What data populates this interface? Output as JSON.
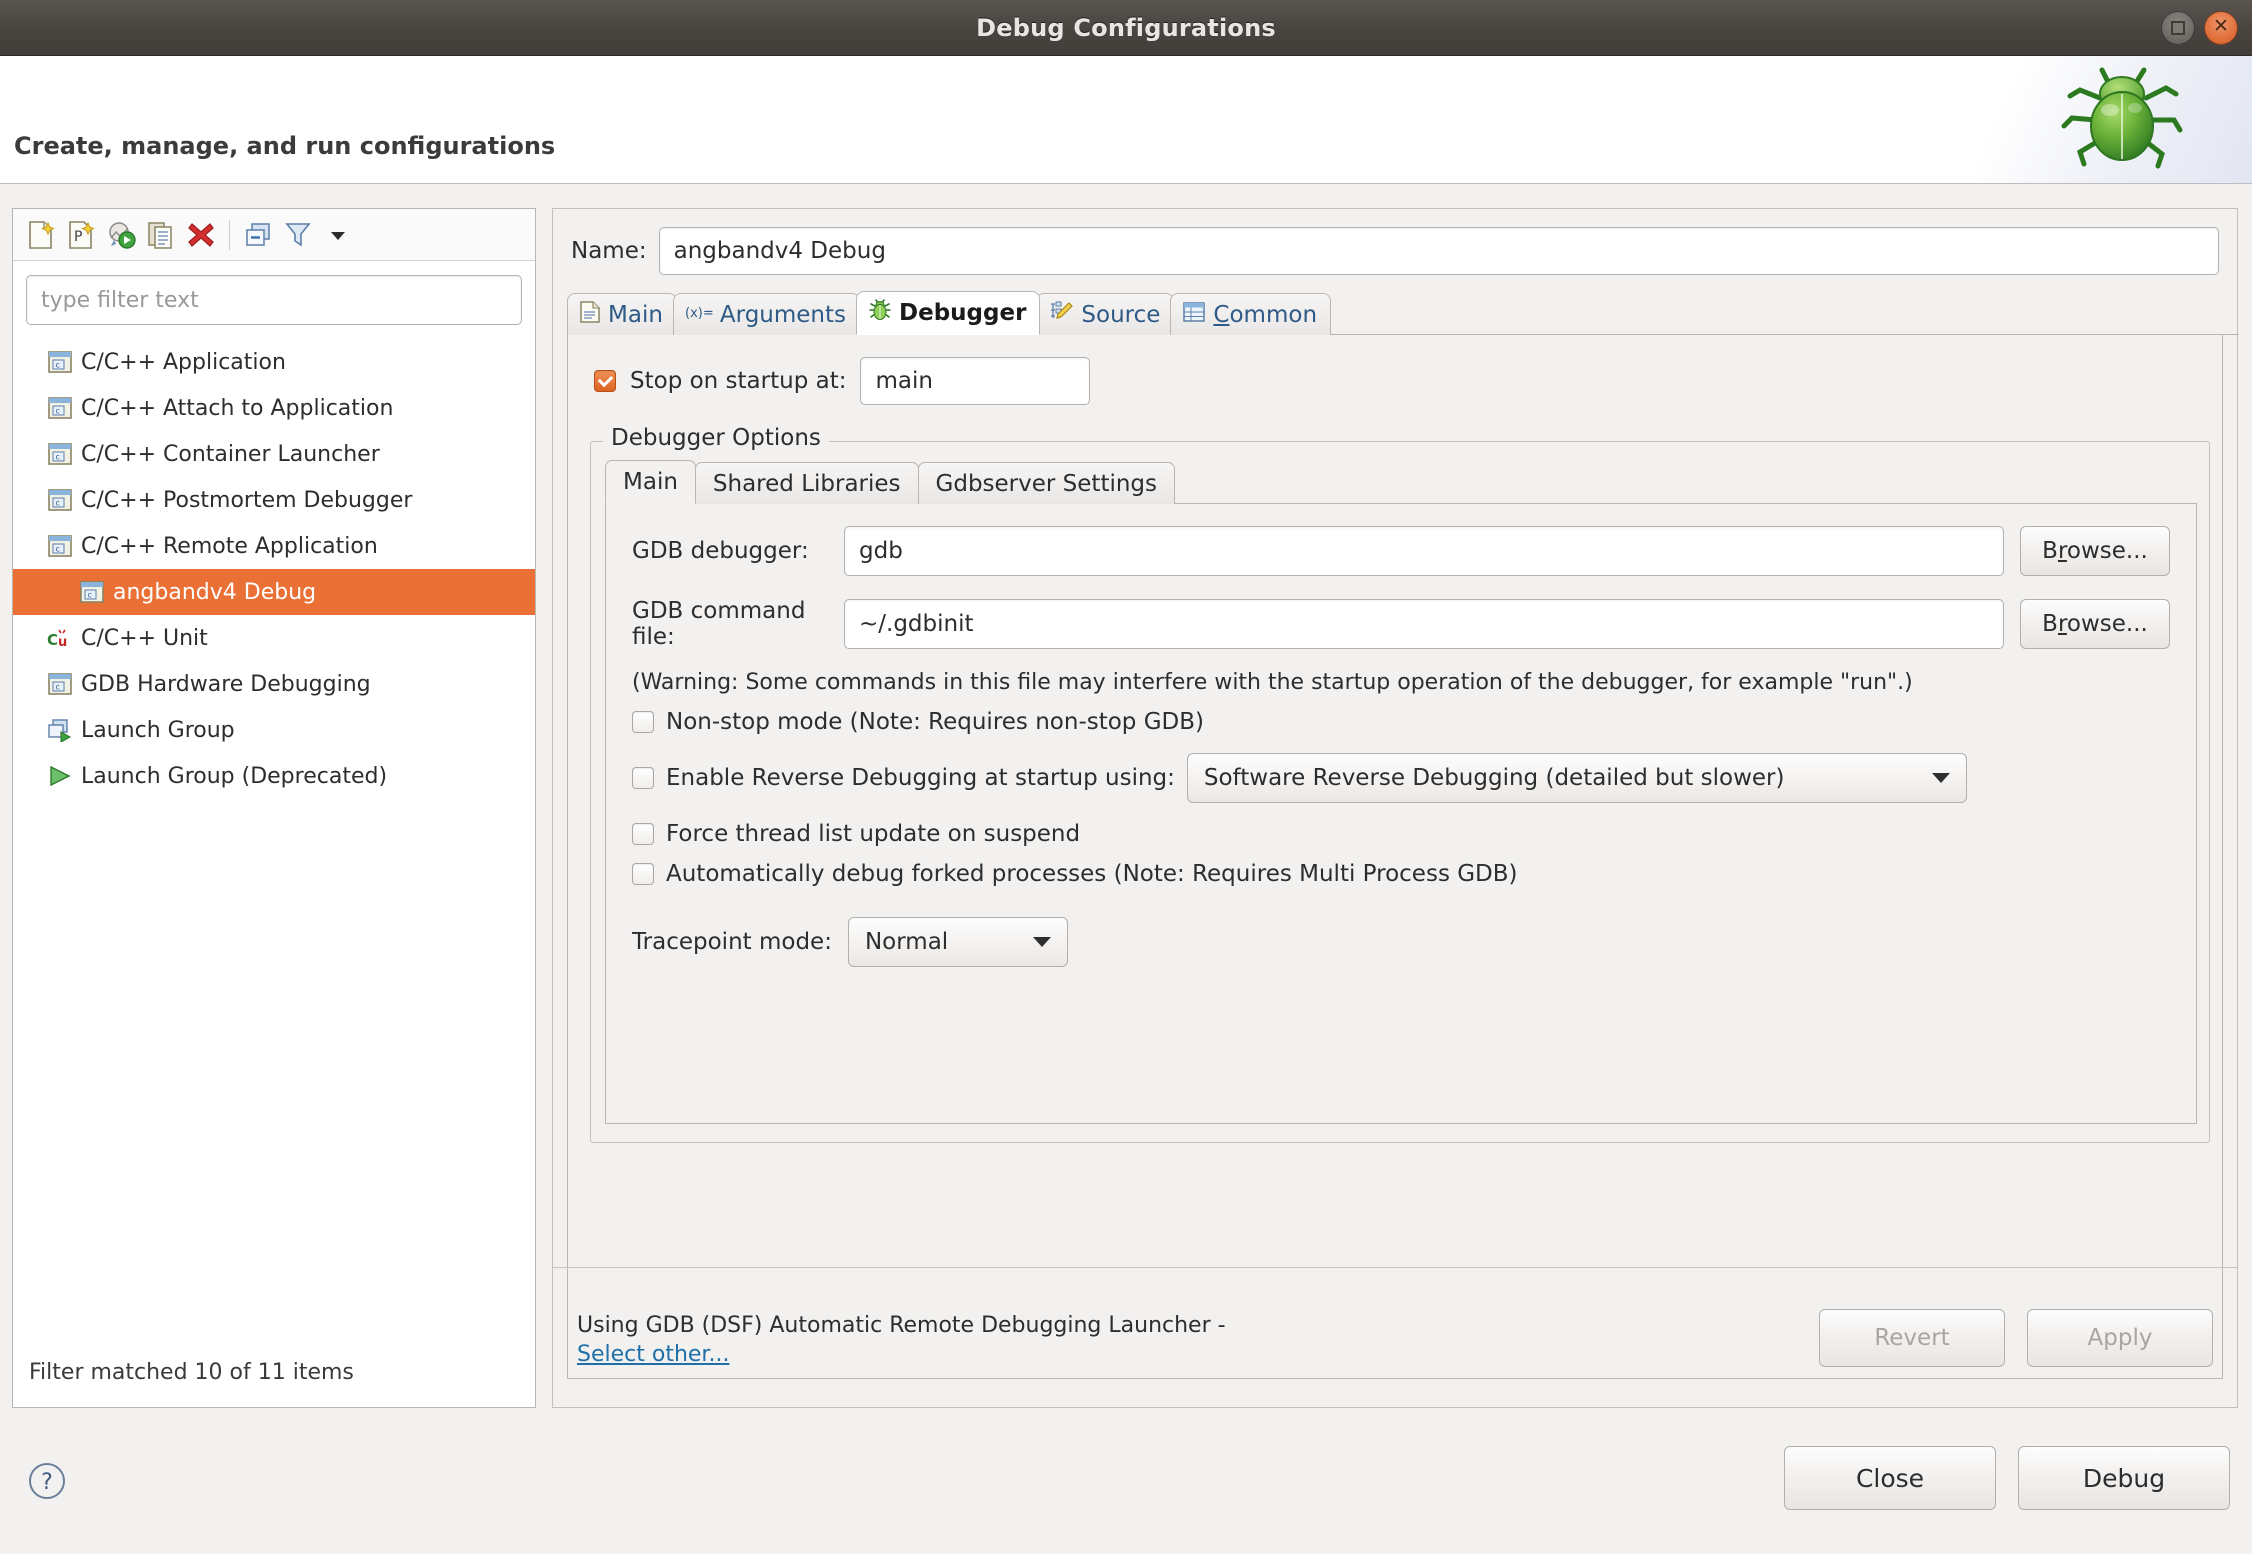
{
  "window": {
    "title": "Debug Configurations",
    "buttons": {
      "restore": "restore",
      "close": "close"
    }
  },
  "header": {
    "title": "Create, manage, and run configurations",
    "icon": "bug-illustration"
  },
  "left_panel": {
    "toolbar_icons": [
      "new-launch-configuration-icon",
      "new-prototype-icon",
      "new-launch-group-icon",
      "duplicate-icon",
      "delete-icon",
      "collapse-all-icon",
      "filter-icon",
      "view-menu-icon"
    ],
    "filter": {
      "placeholder": "type filter text",
      "value": ""
    },
    "tree": [
      {
        "label": "C/C++ Application",
        "icon": "c-app-icon",
        "indent": 0,
        "selected": false,
        "twisty": "none"
      },
      {
        "label": "C/C++ Attach to Application",
        "icon": "c-app-icon",
        "indent": 0,
        "selected": false,
        "twisty": "none"
      },
      {
        "label": "C/C++ Container Launcher",
        "icon": "c-app-icon",
        "indent": 0,
        "selected": false,
        "twisty": "none"
      },
      {
        "label": "C/C++ Postmortem Debugger",
        "icon": "c-app-icon",
        "indent": 0,
        "selected": false,
        "twisty": "none"
      },
      {
        "label": "C/C++ Remote Application",
        "icon": "c-app-icon",
        "indent": 0,
        "selected": false,
        "twisty": "expanded"
      },
      {
        "label": "angbandv4 Debug",
        "icon": "c-app-icon",
        "indent": 1,
        "selected": true,
        "twisty": "none"
      },
      {
        "label": "C/C++ Unit",
        "icon": "cpp-unit-icon",
        "indent": 0,
        "selected": false,
        "twisty": "none"
      },
      {
        "label": "GDB Hardware Debugging",
        "icon": "c-app-icon",
        "indent": 0,
        "selected": false,
        "twisty": "none"
      },
      {
        "label": "Launch Group",
        "icon": "launch-group-icon",
        "indent": 0,
        "selected": false,
        "twisty": "none"
      },
      {
        "label": "Launch Group (Deprecated)",
        "icon": "launch-group-deprecated-icon",
        "indent": 0,
        "selected": false,
        "twisty": "none"
      }
    ],
    "filter_status": "Filter matched 10 of 11 items"
  },
  "right_panel": {
    "name_label": "Name:",
    "name_value": "angbandv4 Debug",
    "tabs": [
      {
        "label": "Main",
        "icon": "document-icon",
        "active": false,
        "mnemonic": ""
      },
      {
        "label": "Arguments",
        "icon": "arguments-icon",
        "active": false,
        "mnemonic": ""
      },
      {
        "label": "Debugger",
        "icon": "bug-icon",
        "active": true,
        "mnemonic": ""
      },
      {
        "label": "Source",
        "icon": "source-pencil-icon",
        "active": false,
        "mnemonic": ""
      },
      {
        "label": "Common",
        "icon": "table-icon",
        "active": false,
        "mnemonic": "C"
      }
    ],
    "stop_on_startup": {
      "label": "Stop on startup at:",
      "checked": true,
      "value": "main"
    },
    "debugger_options": {
      "group_title": "Debugger Options",
      "inner_tabs": [
        {
          "label": "Main",
          "active": true
        },
        {
          "label": "Shared Libraries",
          "active": false
        },
        {
          "label": "Gdbserver Settings",
          "active": false
        }
      ],
      "gdb_debugger": {
        "label": "GDB debugger:",
        "value": "gdb",
        "browse_label": "Browse...",
        "browse_mnemonic": "r"
      },
      "gdb_command_file": {
        "label": "GDB command file:",
        "value": "~/.gdbinit",
        "browse_label": "Browse...",
        "browse_mnemonic": "r"
      },
      "warning": "(Warning: Some commands in this file may interfere with the startup operation of the debugger, for example \"run\".)",
      "checkboxes": [
        {
          "label": "Non-stop mode (Note: Requires non-stop GDB)",
          "checked": false
        },
        {
          "label": "Force thread list update on suspend",
          "checked": false
        },
        {
          "label": "Automatically debug forked processes (Note: Requires Multi Process GDB)",
          "checked": false
        }
      ],
      "reverse_debugging": {
        "label": "Enable Reverse Debugging at startup using:",
        "checked": false,
        "selected_option": "Software Reverse Debugging (detailed but slower)"
      },
      "tracepoint_mode": {
        "label": "Tracepoint mode:",
        "selected_option": "Normal"
      }
    },
    "footer": {
      "launcher_text": "Using GDB (DSF) Automatic Remote Debugging Launcher -",
      "select_other_link": "Select other...",
      "revert_label": "Revert",
      "revert_disabled": true,
      "apply_label": "Apply",
      "apply_disabled": true
    }
  },
  "bottom_bar": {
    "help_icon": "help-icon",
    "close_label": "Close",
    "debug_label": "Debug"
  },
  "colors": {
    "selection_orange": "#ea7035",
    "checkbox_orange": "#dd6522",
    "link_blue": "#1f6fa8",
    "titlebar_dark": "#4a4541",
    "panel_bg": "#f2f1f0"
  }
}
